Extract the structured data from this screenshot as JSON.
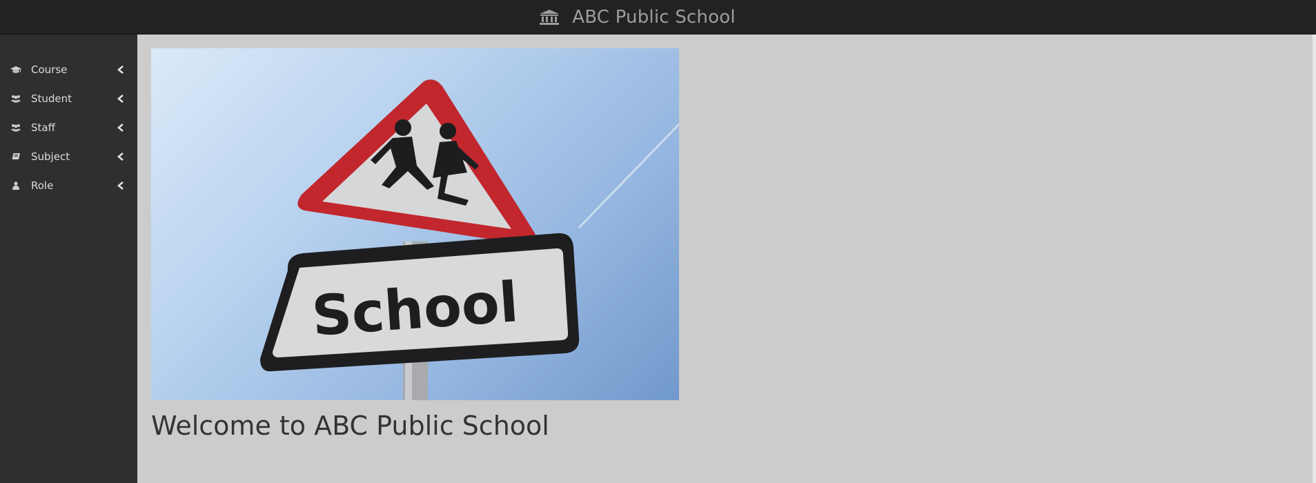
{
  "app": {
    "title": "ABC Public School",
    "brand_icon": "institution-icon"
  },
  "sidebar": {
    "items": [
      {
        "label": "Course",
        "icon": "graduation-cap-icon"
      },
      {
        "label": "Student",
        "icon": "users-icon"
      },
      {
        "label": "Staff",
        "icon": "users-icon"
      },
      {
        "label": "Subject",
        "icon": "book-icon"
      },
      {
        "label": "Role",
        "icon": "user-icon"
      }
    ]
  },
  "main": {
    "hero_image": {
      "depicts": "school crossing road sign",
      "sign_text": "School"
    },
    "welcome": "Welcome to ABC Public School"
  },
  "colors": {
    "topbar": "#222222",
    "sidebar": "#2f2f2f",
    "content_bg": "#cccccc",
    "sign_red": "#c1272d"
  }
}
